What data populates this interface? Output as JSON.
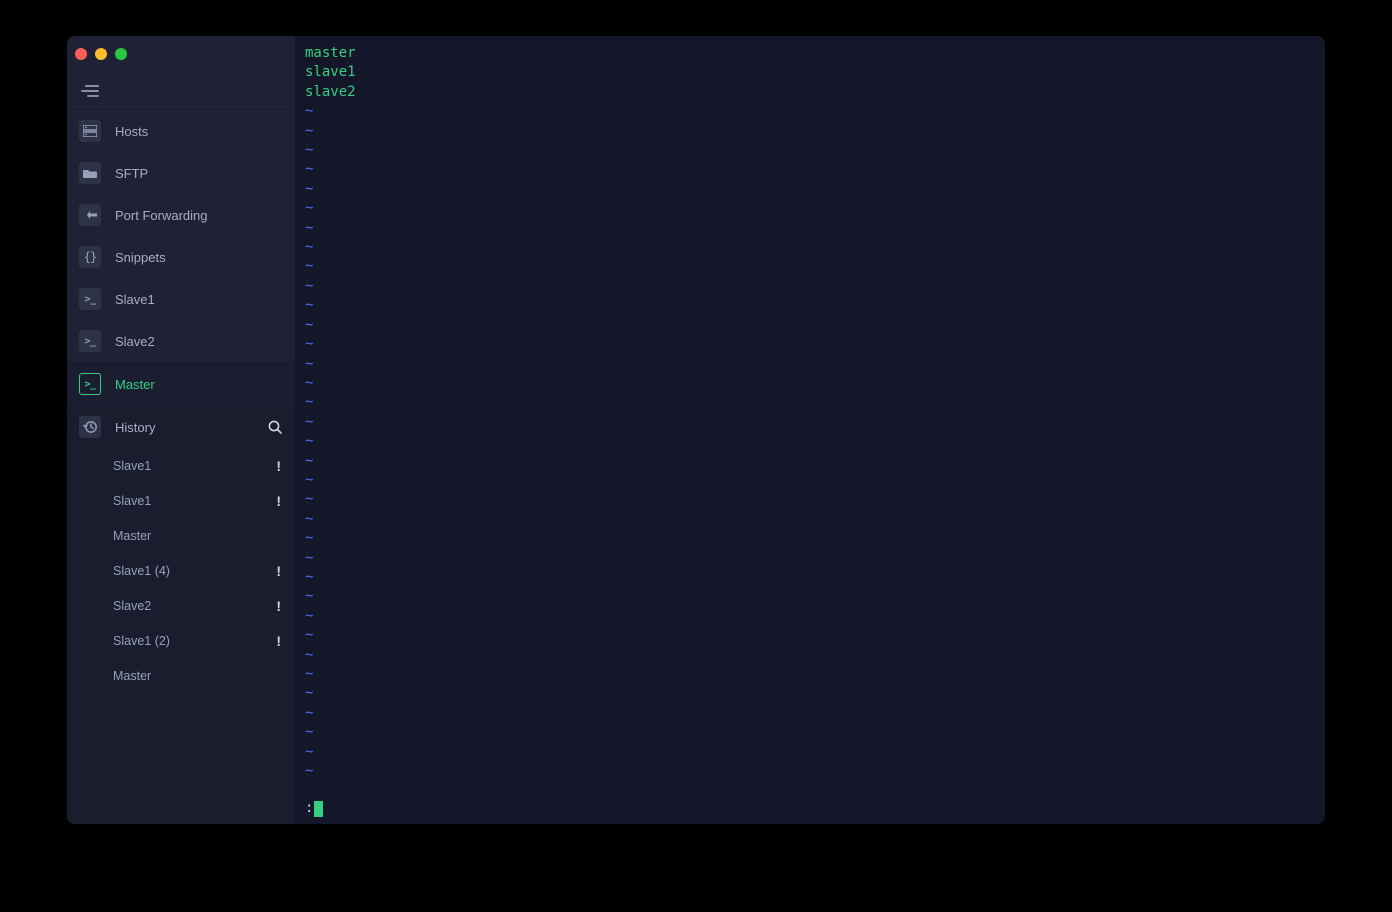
{
  "sidebar": {
    "nav": {
      "hosts": {
        "label": "Hosts"
      },
      "sftp": {
        "label": "SFTP"
      },
      "portfw": {
        "label": "Port Forwarding"
      },
      "snippets": {
        "label": "Snippets"
      },
      "slave1": {
        "label": "Slave1"
      },
      "slave2": {
        "label": "Slave2"
      },
      "master": {
        "label": "Master"
      }
    },
    "history": {
      "title": "History",
      "items": [
        {
          "label": "Slave1",
          "alert": true
        },
        {
          "label": "Slave1",
          "alert": true
        },
        {
          "label": "Master",
          "alert": false
        },
        {
          "label": "Slave1 (4)",
          "alert": true
        },
        {
          "label": "Slave2",
          "alert": true
        },
        {
          "label": "Slave1 (2)",
          "alert": true
        },
        {
          "label": "Master",
          "alert": false
        }
      ]
    }
  },
  "terminal": {
    "content_lines": [
      "master",
      "slave1",
      "slave2"
    ],
    "tilde_char": "~",
    "status_prefix": ":"
  }
}
